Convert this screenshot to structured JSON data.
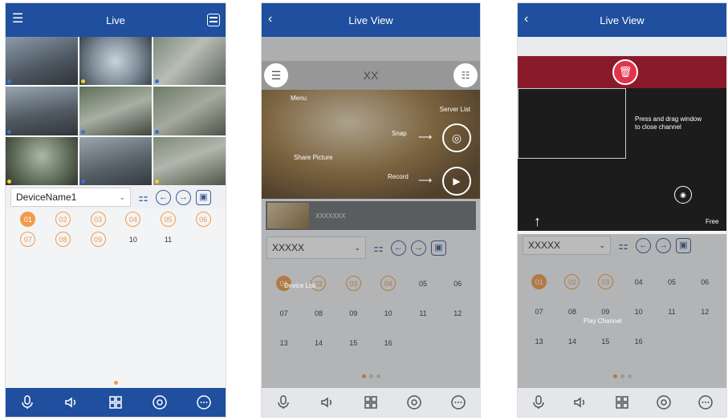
{
  "screen1": {
    "title": "Live",
    "device_select": "DeviceName1",
    "channels": [
      "01",
      "02",
      "03",
      "04",
      "05",
      "06",
      "07",
      "08",
      "09",
      "10",
      "11"
    ],
    "selected_channel": "01"
  },
  "screen2": {
    "title": "Live View",
    "server_bar": "XX",
    "device_select": "XXXXX",
    "thumb_label": "XXXXXXX",
    "channels": [
      "01",
      "02",
      "03",
      "04",
      "05",
      "06",
      "07",
      "08",
      "09",
      "10",
      "11",
      "12",
      "13",
      "14",
      "15",
      "16"
    ],
    "annotations": {
      "menu": "Menu",
      "server_list": "Server List",
      "snap": "Snap",
      "share_picture": "Share Picture",
      "record": "Record",
      "device_list": "Device List"
    }
  },
  "screen3": {
    "title": "Live View",
    "device_select": "XXXXX",
    "channels": [
      "01",
      "02",
      "03",
      "04",
      "05",
      "06",
      "07",
      "08",
      "09",
      "10",
      "11",
      "12",
      "13",
      "14",
      "15",
      "16"
    ],
    "annotations": {
      "drag_close": "Press and drag window to close channel",
      "free": "Free",
      "play_channel": "Play Channel"
    }
  },
  "colors": {
    "bar": "#1f4f9e",
    "accent": "#f29b4a",
    "trash": "#e0344b"
  }
}
